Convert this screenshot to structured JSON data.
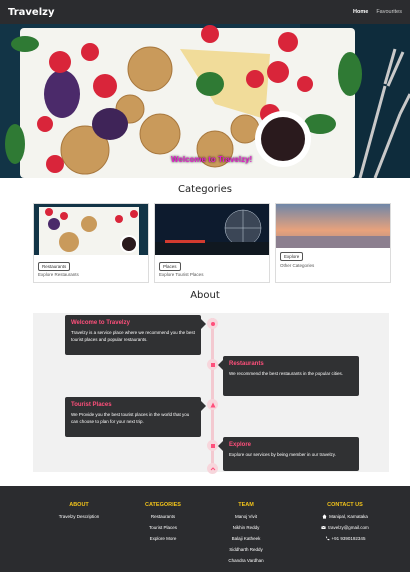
{
  "navbar": {
    "brand": "Travelzy",
    "links": [
      {
        "label": "Home"
      },
      {
        "label": "Favourites"
      }
    ]
  },
  "hero": {
    "title": "Welcome to Travelzy!"
  },
  "categories": {
    "title": "Categories",
    "cards": [
      {
        "button": "Restaurants",
        "desc": "Explore Restaurants"
      },
      {
        "button": "Places",
        "desc": "Explore Tourist Places"
      },
      {
        "button": "Explore",
        "desc": "Other Categories"
      }
    ]
  },
  "about": {
    "title": "About",
    "items": [
      {
        "title": "Welcome to Travelzy",
        "body": "Travelzy is a service place where we recommend you the best tourist places and popular restaurants."
      },
      {
        "title": "Restaurants",
        "body": "We recommend the best restaurants in the popular cities."
      },
      {
        "title": "Tourist Places",
        "body": "We Provide you the best tourist places in the world that you can choose to plan for your next trip."
      },
      {
        "title": "Explore",
        "body": "Explore our services by being member in our travelzy."
      }
    ]
  },
  "footer": {
    "about": {
      "heading": "ABOUT",
      "items": [
        "Travelzy Description"
      ]
    },
    "categories": {
      "heading": "CATEGORIES",
      "items": [
        "Restaurants",
        "Tourist Places",
        "Explore More"
      ]
    },
    "team": {
      "heading": "TEAM",
      "items": [
        "Manoj Vivit",
        "Nikhin Reddy",
        "Balaji Katheek",
        "Siddharth Reddy",
        "Chandra Vardhan"
      ]
    },
    "contact": {
      "heading": "CONTACT US",
      "items": [
        "Manipal, Karnataka",
        "travelzy@gmail.com",
        "+91 9390192345"
      ]
    }
  },
  "colors": {
    "accent": "#ff4f7b",
    "footer_heading": "#f2c31a",
    "navbar": "#2b2c2f"
  }
}
